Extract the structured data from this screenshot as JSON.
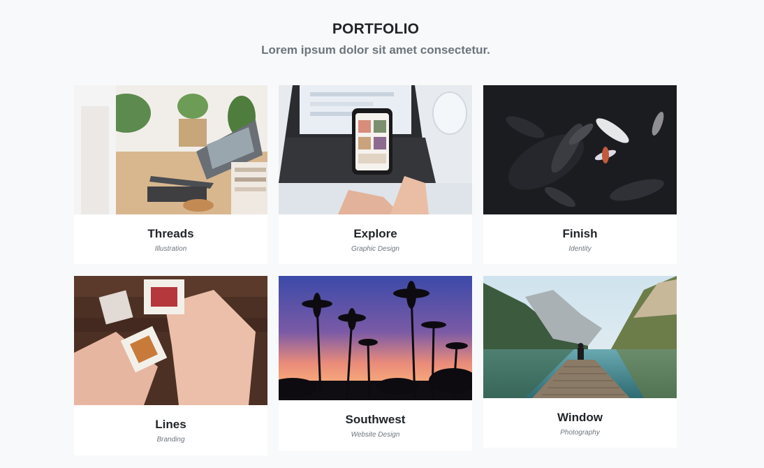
{
  "section": {
    "title": "PORTFOLIO",
    "subtitle": "Lorem ipsum dolor sit amet consectetur."
  },
  "items": [
    {
      "title": "Threads",
      "category": "Illustration"
    },
    {
      "title": "Explore",
      "category": "Graphic Design"
    },
    {
      "title": "Finish",
      "category": "Identity"
    },
    {
      "title": "Lines",
      "category": "Branding"
    },
    {
      "title": "Southwest",
      "category": "Website Design"
    },
    {
      "title": "Window",
      "category": "Photography"
    }
  ]
}
